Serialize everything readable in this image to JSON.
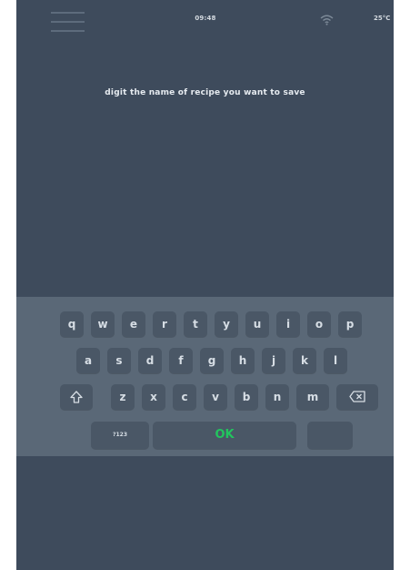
{
  "status_bar": {
    "menu_icon": "hamburger-menu-icon",
    "time": "09:48",
    "wifi_icon": "wifi-icon",
    "temperature": "25°C"
  },
  "prompt": {
    "text": "digit the name of recipe you want to save"
  },
  "keyboard": {
    "row1": [
      "q",
      "w",
      "e",
      "r",
      "t",
      "y",
      "u",
      "i",
      "o",
      "p"
    ],
    "row2": [
      "a",
      "s",
      "d",
      "f",
      "g",
      "h",
      "j",
      "k",
      "l"
    ],
    "row3": [
      "z",
      "x",
      "c",
      "v",
      "b",
      "n",
      "m"
    ],
    "shift_icon": "shift-arrow-icon",
    "backspace_icon": "backspace-icon",
    "numbers_label": "?123",
    "ok_label": "OK",
    "ok_color": "#22c55e"
  },
  "colors": {
    "background": "#3e4b5c",
    "keyboard": "#5a6877",
    "key": "#4a5766"
  }
}
